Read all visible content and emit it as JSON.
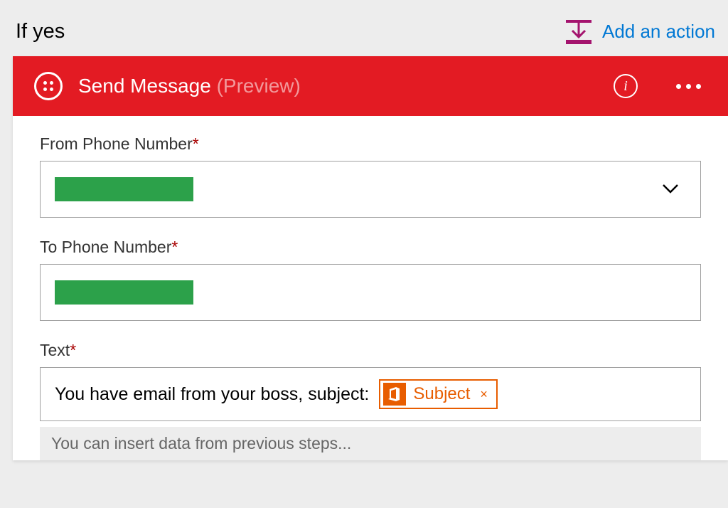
{
  "branch": {
    "title": "If yes",
    "addActionLabel": "Add an action"
  },
  "card": {
    "title": "Send Message",
    "titleSuffix": "(Preview)"
  },
  "fields": {
    "fromPhone": {
      "label": "From Phone Number",
      "required": "*"
    },
    "toPhone": {
      "label": "To Phone Number",
      "required": "*"
    },
    "text": {
      "label": "Text",
      "required": "*",
      "value": "You have email from your boss, subject:",
      "token": {
        "label": "Subject",
        "removeGlyph": "×"
      }
    }
  },
  "hint": "You can insert data from previous steps...",
  "colors": {
    "headerBg": "#e31b23",
    "link": "#0078d4",
    "addIcon": "#a4146e",
    "token": "#e85d00",
    "redacted": "#2ca14a"
  }
}
